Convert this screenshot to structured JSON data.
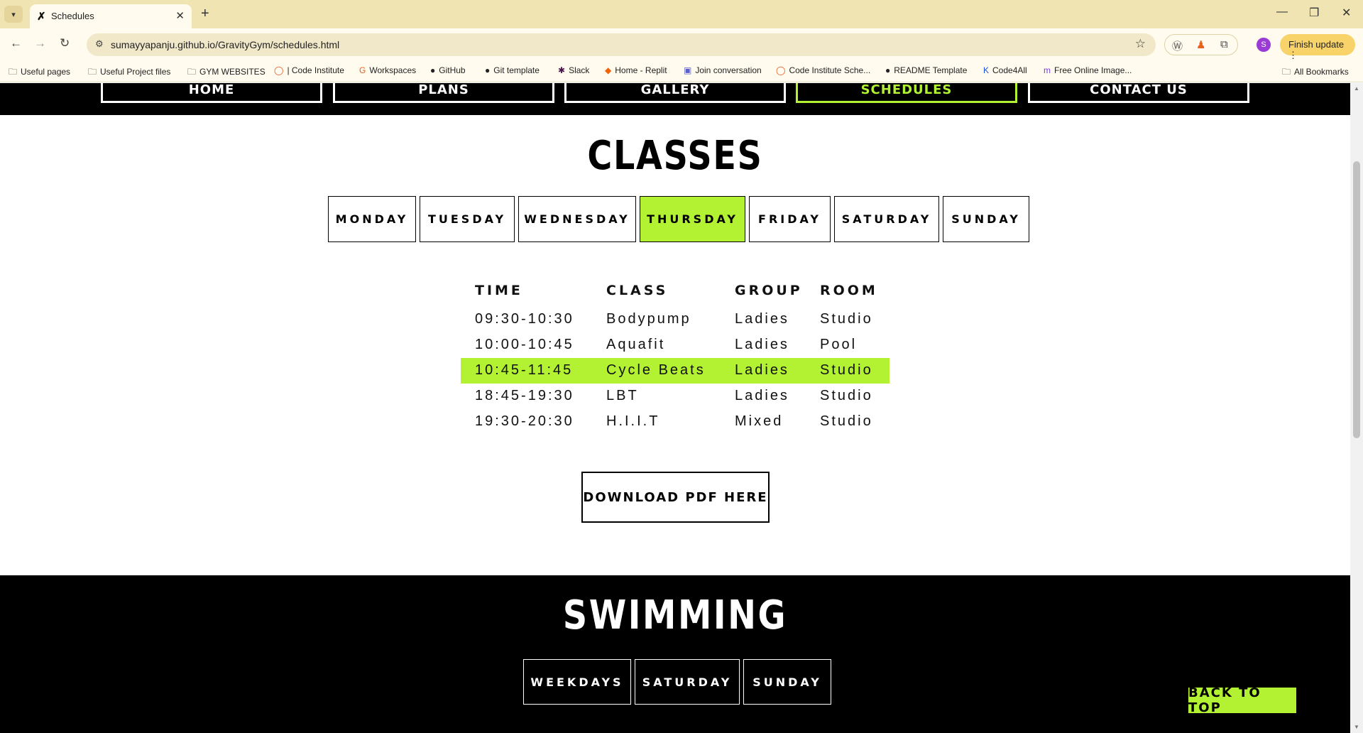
{
  "browser": {
    "tab_title": "Schedules",
    "url": "sumayyapanju.github.io/GravityGym/schedules.html",
    "profile_initial": "S",
    "update_label": "Finish update",
    "bookmarks": [
      "Useful pages",
      "Useful Project files",
      "GYM WEBSITES",
      "| Code Institute",
      "Workspaces",
      "GitHub",
      "Git template",
      "Slack",
      "Home - Replit",
      "Join conversation",
      "Code Institute Sche...",
      "README Template",
      "Code4All",
      "Free Online Image..."
    ],
    "all_bookmarks": "All Bookmarks"
  },
  "nav": {
    "items": [
      "HOME",
      "PLANS",
      "GALLERY",
      "SCHEDULES",
      "CONTACT US"
    ],
    "active": "SCHEDULES"
  },
  "classes": {
    "title": "CLASSES",
    "days": [
      "MONDAY",
      "TUESDAY",
      "WEDNESDAY",
      "THURSDAY",
      "FRIDAY",
      "SATURDAY",
      "SUNDAY"
    ],
    "active_day": "THURSDAY",
    "headers": [
      "TIME",
      "CLASS",
      "GROUP",
      "ROOM"
    ],
    "rows": [
      [
        "09:30-10:30",
        "Bodypump",
        "Ladies",
        "Studio"
      ],
      [
        "10:00-10:45",
        "Aquafit",
        "Ladies",
        "Pool"
      ],
      [
        "10:45-11:45",
        "Cycle Beats",
        "Ladies",
        "Studio"
      ],
      [
        "18:45-19:30",
        "LBT",
        "Ladies",
        "Studio"
      ],
      [
        "19:30-20:30",
        "H.I.I.T",
        "Mixed",
        "Studio"
      ]
    ],
    "highlighted_row": 2,
    "download_label": "DOWNLOAD PDF HERE"
  },
  "swimming": {
    "title": "SWIMMING",
    "days": [
      "WEEKDAYS",
      "SATURDAY",
      "SUNDAY"
    ]
  },
  "back_to_top": "BACK TO TOP",
  "colors": {
    "accent": "#b2f232",
    "chrome": "#f1e4b3"
  }
}
